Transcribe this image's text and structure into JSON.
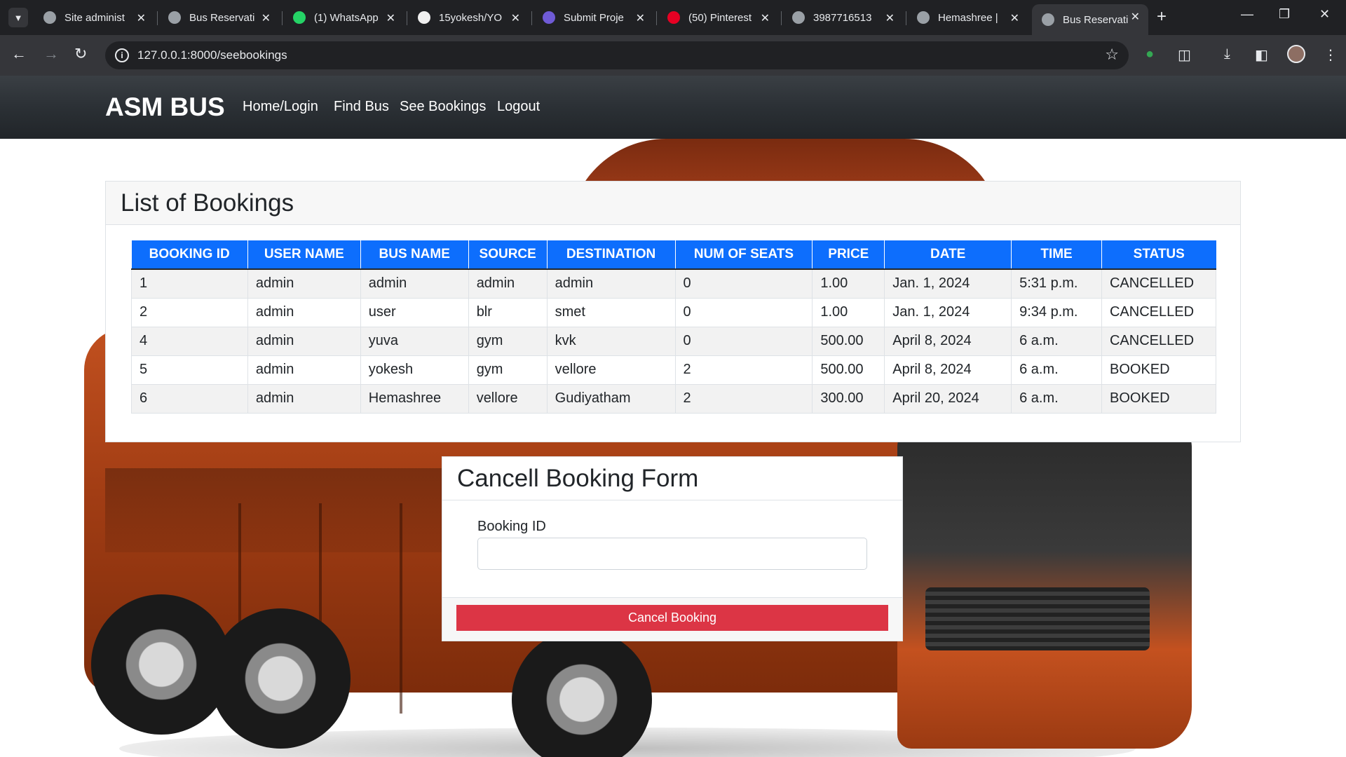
{
  "browser": {
    "tabs": [
      {
        "title": "Site administ",
        "icon": "globe-icon"
      },
      {
        "title": "Bus Reservati",
        "icon": "globe-icon"
      },
      {
        "title": "(1) WhatsApp",
        "icon": "whatsapp-icon"
      },
      {
        "title": "15yokesh/YO",
        "icon": "github-icon"
      },
      {
        "title": "Submit Proje",
        "icon": "app-icon"
      },
      {
        "title": "(50) Pinterest",
        "icon": "pinterest-icon"
      },
      {
        "title": "3987716513",
        "icon": "globe-icon"
      },
      {
        "title": "Hemashree |",
        "icon": "globe-icon"
      },
      {
        "title": "Bus Reservati",
        "icon": "globe-icon",
        "active": true
      }
    ],
    "url": "127.0.0.1:8000/seebookings"
  },
  "navbar": {
    "brand": "ASM BUS",
    "links": [
      "Home/Login",
      "Find Bus",
      "See Bookings",
      "Logout"
    ]
  },
  "bookings": {
    "title": "List of Bookings",
    "columns": [
      "BOOKING ID",
      "USER NAME",
      "BUS NAME",
      "SOURCE",
      "DESTINATION",
      "NUM OF SEATS",
      "PRICE",
      "DATE",
      "TIME",
      "STATUS"
    ],
    "rows": [
      [
        "1",
        "admin",
        "admin",
        "admin",
        "admin",
        "0",
        "1.00",
        "Jan. 1, 2024",
        "5:31 p.m.",
        "CANCELLED"
      ],
      [
        "2",
        "admin",
        "user",
        "blr",
        "smet",
        "0",
        "1.00",
        "Jan. 1, 2024",
        "9:34 p.m.",
        "CANCELLED"
      ],
      [
        "4",
        "admin",
        "yuva",
        "gym",
        "kvk",
        "0",
        "500.00",
        "April 8, 2024",
        "6 a.m.",
        "CANCELLED"
      ],
      [
        "5",
        "admin",
        "yokesh",
        "gym",
        "vellore",
        "2",
        "500.00",
        "April 8, 2024",
        "6 a.m.",
        "BOOKED"
      ],
      [
        "6",
        "admin",
        "Hemashree",
        "vellore",
        "Gudiyatham",
        "2",
        "300.00",
        "April 20, 2024",
        "6 a.m.",
        "BOOKED"
      ]
    ]
  },
  "cancel_form": {
    "title": "Cancell Booking Form",
    "field_label": "Booking ID",
    "field_value": "",
    "button_label": "Cancel Booking"
  },
  "colors": {
    "table_header": "#0d6efd",
    "cancel_button": "#dc3545",
    "navbar": "#212529"
  }
}
